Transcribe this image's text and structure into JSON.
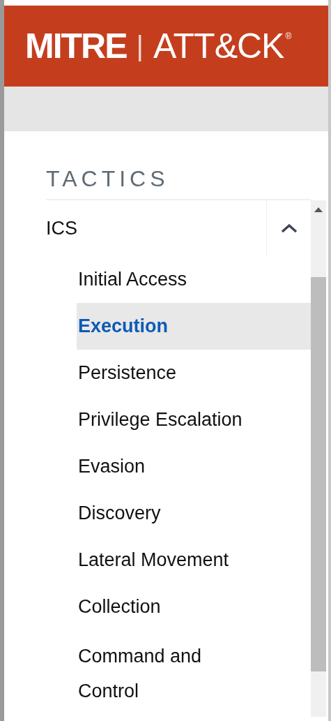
{
  "header": {
    "logo_left": "MITRE",
    "logo_separator": "|",
    "logo_right": "ATT&CK",
    "logo_mark": "®"
  },
  "sidebar": {
    "heading": "TACTICS",
    "groups": [
      {
        "label": "ICS",
        "expanded": true,
        "items": [
          {
            "label": "Initial Access",
            "selected": false
          },
          {
            "label": "Execution",
            "selected": true
          },
          {
            "label": "Persistence",
            "selected": false
          },
          {
            "label": "Privilege Escalation",
            "selected": false
          },
          {
            "label": "Evasion",
            "selected": false
          },
          {
            "label": "Discovery",
            "selected": false
          },
          {
            "label": "Lateral Movement",
            "selected": false
          },
          {
            "label": "Collection",
            "selected": false
          },
          {
            "label": "Command and Control",
            "selected": false
          }
        ]
      }
    ]
  }
}
